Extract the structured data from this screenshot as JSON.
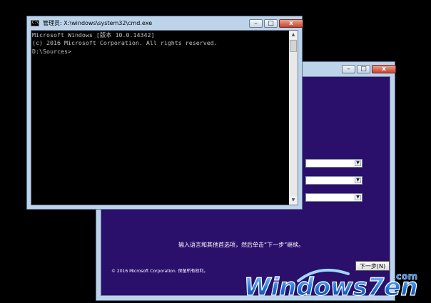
{
  "setup_window": {
    "controls": {
      "minimize": "–",
      "maximize": "□",
      "close": "x"
    },
    "instruction": "输入语言和其他首选项，然后单击“下一步”继续。",
    "copyright": "© 2016 Microsoft Corporation. 保留所有权利。",
    "next_button": "下一步(N)",
    "dropdown_arrow": "▼"
  },
  "cmd_window": {
    "icon_text": "C:\\",
    "title": "管理员: X:\\windows\\system32\\cmd.exe",
    "controls": {
      "minimize": "–",
      "maximize": "□",
      "close": "x"
    },
    "console_lines": [
      "Microsoft Windows [版本 10.0.14342]",
      "(c) 2016 Microsoft Corporation. All rights reserved.",
      "",
      "D:\\Sources>"
    ],
    "scroll_up": "▲",
    "scroll_down": "▼"
  },
  "watermark": {
    "brand": "Windows7en",
    "suffix": ".com"
  },
  "colors": {
    "setup_background": "#2a0f6b",
    "console_text": "#c0c0c0",
    "window_frame": "#bcd3ea",
    "watermark_blue": "#1d6fd8"
  }
}
